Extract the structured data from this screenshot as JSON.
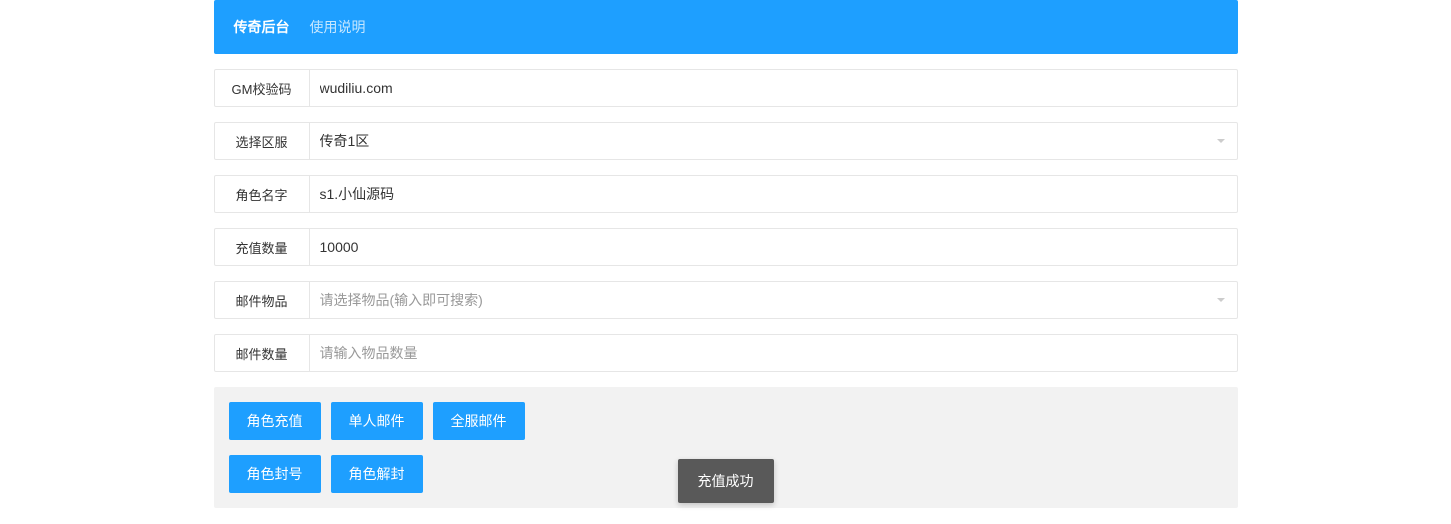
{
  "navbar": {
    "tab1": "传奇后台",
    "tab2": "使用说明"
  },
  "form": {
    "gmcode": {
      "label": "GM校验码",
      "value": "wudiliu.com"
    },
    "server": {
      "label": "选择区服",
      "value": "传奇1区"
    },
    "rolename": {
      "label": "角色名字",
      "value": "s1.小仙源码"
    },
    "amount": {
      "label": "充值数量",
      "value": "10000"
    },
    "mailitem": {
      "label": "邮件物品",
      "placeholder": "请选择物品(输入即可搜索)"
    },
    "mailqty": {
      "label": "邮件数量",
      "placeholder": "请输入物品数量"
    }
  },
  "buttons": {
    "recharge": "角色充值",
    "singlemail": "单人邮件",
    "allmail": "全服邮件",
    "ban": "角色封号",
    "unban": "角色解封"
  },
  "toast": {
    "message": "充值成功"
  }
}
